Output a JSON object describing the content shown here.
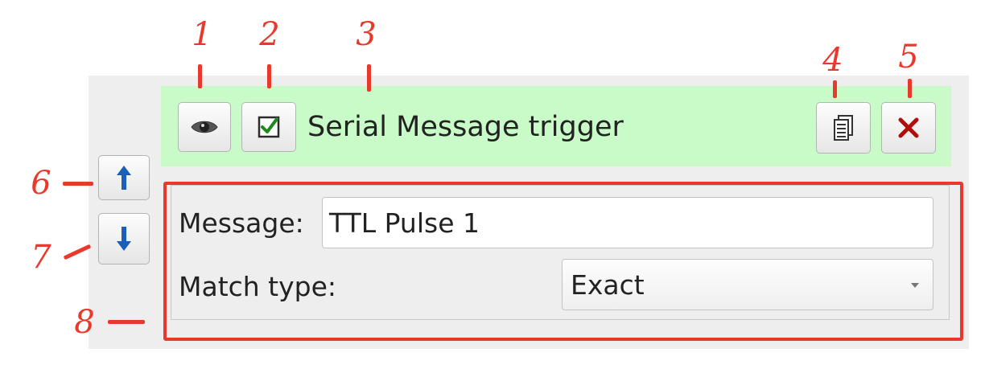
{
  "header": {
    "title": "Serial Message trigger",
    "color": "#c9fbc9"
  },
  "form": {
    "message_label": "Message:",
    "message_value": "TTL Pulse 1",
    "match_type_label": "Match type:",
    "match_type_value": "Exact"
  },
  "icons": {
    "visibility": "eye-icon",
    "enabled": "checkbox-checked-icon",
    "duplicate": "copy-icon",
    "delete": "close-icon",
    "move_up": "arrow-up-icon",
    "move_down": "arrow-down-icon"
  },
  "annotations": {
    "color": "#e8392c",
    "numbers": [
      "1",
      "2",
      "3",
      "4",
      "5",
      "6",
      "7",
      "8"
    ]
  }
}
